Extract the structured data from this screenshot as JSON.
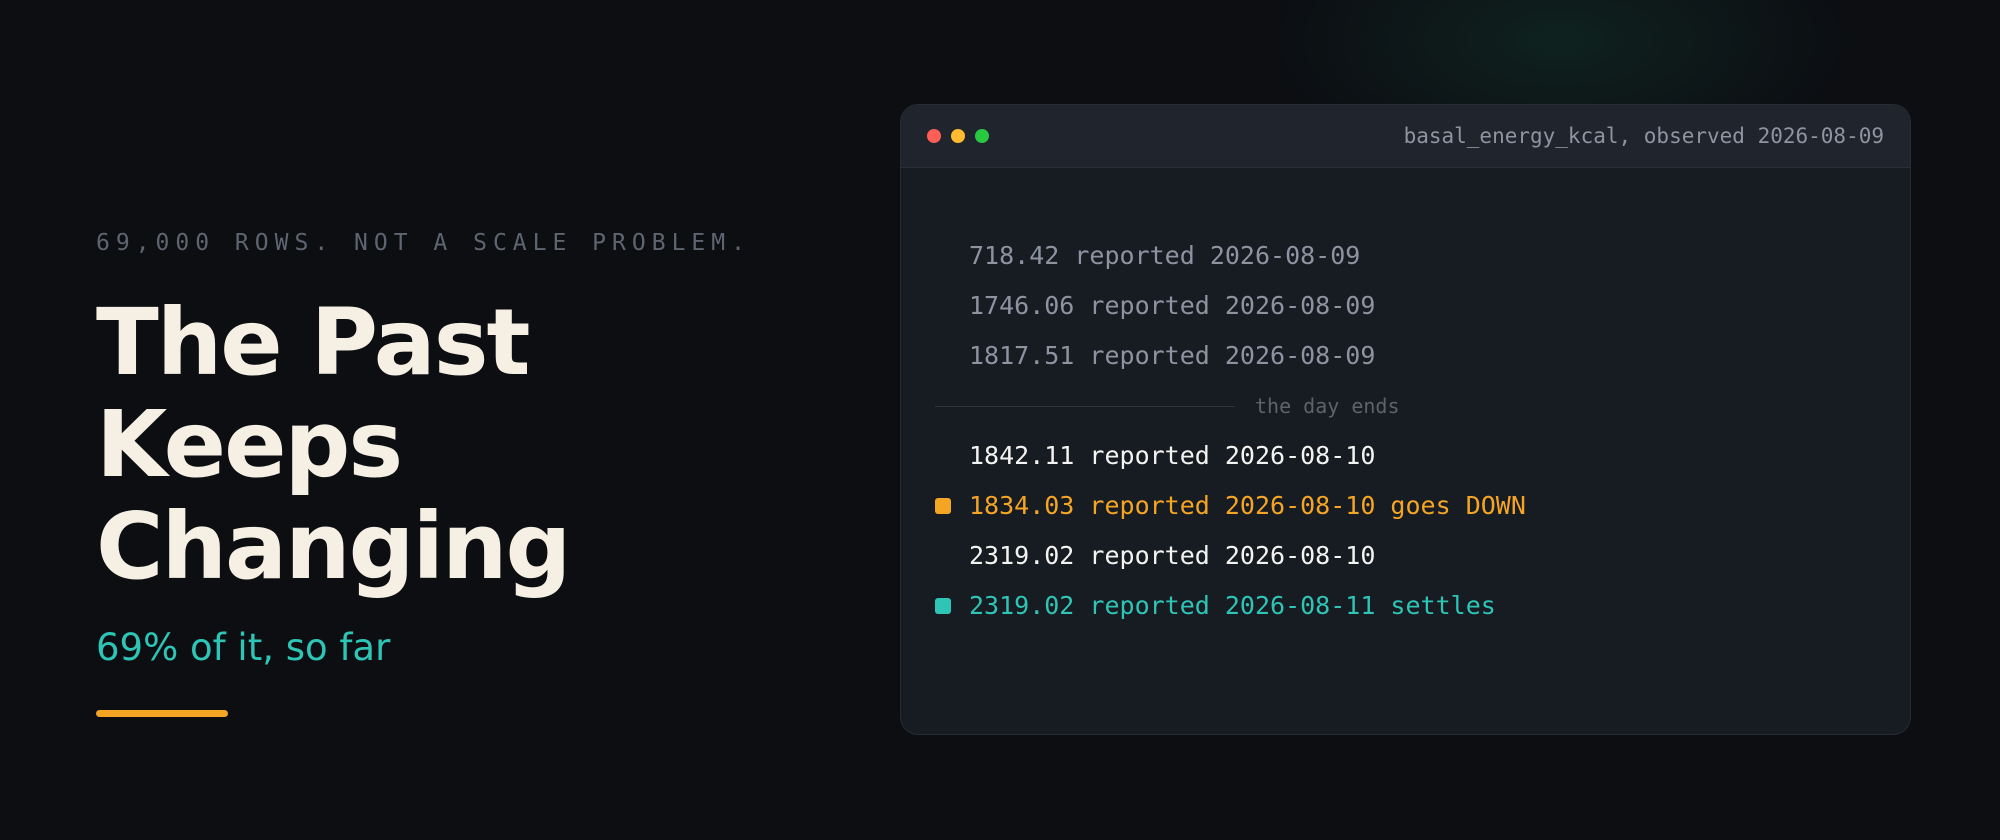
{
  "hero": {
    "eyebrow": "69,000 ROWS. NOT A SCALE PROBLEM.",
    "title_line1": "The Past Keeps",
    "title_line2": "Changing",
    "subtitle": "69% of it, so far"
  },
  "window": {
    "title": "basal_energy_kcal, observed 2026-08-09",
    "rows_before": [
      "718.42 reported 2026-08-09",
      "1746.06 reported 2026-08-09",
      "1817.51 reported 2026-08-09"
    ],
    "divider_label": "the day ends",
    "rows_after": [
      "1842.11 reported 2026-08-10",
      "1834.03 reported 2026-08-10 goes DOWN",
      "2319.02 reported 2026-08-10",
      "2319.02 reported 2026-08-11 settles"
    ]
  },
  "colors": {
    "background": "#0c0e12",
    "title": "#f5efe4",
    "teal": "#2ec4b6",
    "orange": "#f5a524",
    "muted": "#8b94a0"
  }
}
